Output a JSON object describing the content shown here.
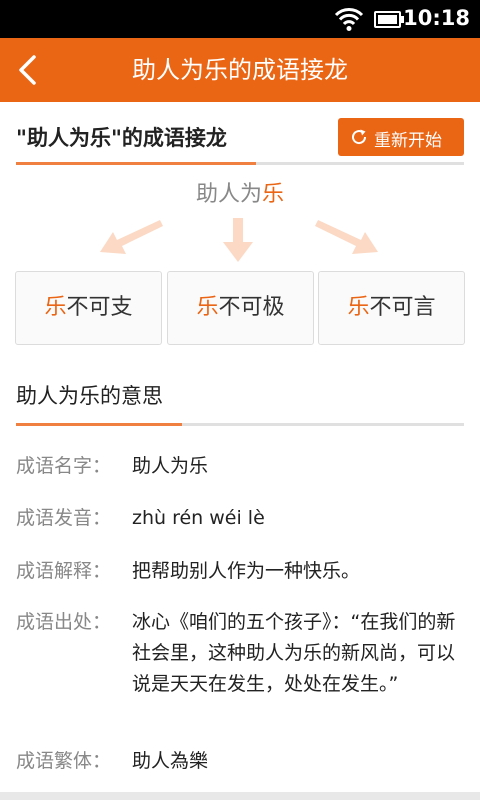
{
  "status_bar": {
    "time": "10:18"
  },
  "app_bar": {
    "title": "助人为乐的成语接龙"
  },
  "chain_section": {
    "heading": "\"助人为乐\"的成语接龙",
    "restart_label": "重新开始"
  },
  "current_idiom": {
    "prefix": "助人为",
    "last_char": "乐"
  },
  "chain_options": [
    {
      "first_char": "乐",
      "rest": "不可支"
    },
    {
      "first_char": "乐",
      "rest": "不可极"
    },
    {
      "first_char": "乐",
      "rest": "不可言"
    }
  ],
  "meaning_section": {
    "title": "助人为乐的意思"
  },
  "info_rows": [
    {
      "label": "成语名字：",
      "value": "助人为乐"
    },
    {
      "label": "成语发音：",
      "value": "zhù rén wéi lè"
    },
    {
      "label": "成语解释：",
      "value": "把帮助别人作为一种快乐。"
    },
    {
      "label": "成语出处：",
      "value": "冰心《咱们的五个孩子》：“在我们的新社会里，这种助人为乐的新风尚，可以说是天天在发生，处处在发生。”"
    },
    {
      "label": "成语繁体：",
      "value": "助人為樂"
    }
  ],
  "colors": {
    "accent": "#ea6514",
    "underline": "#f08040",
    "muted_text": "#888888"
  },
  "icons": {
    "back": "chevron-left-icon",
    "restart": "refresh-icon",
    "wifi": "wifi-icon",
    "battery": "battery-icon"
  }
}
